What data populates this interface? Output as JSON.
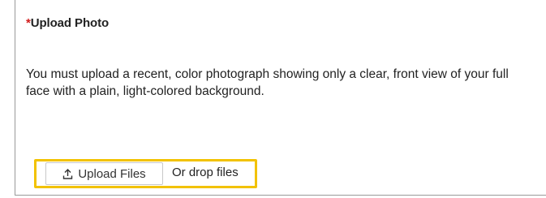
{
  "upload_field": {
    "required_marker": "*",
    "label": "Upload Photo",
    "instructions": "You must upload a recent, color photograph showing only a clear, front view of your full face with a plain, light-colored background.",
    "upload_button_label": "Upload Files",
    "upload_icon": "upload-icon",
    "drop_text": "Or drop files",
    "highlight_color": "#f2c200",
    "required_color": "#d11a1a"
  }
}
